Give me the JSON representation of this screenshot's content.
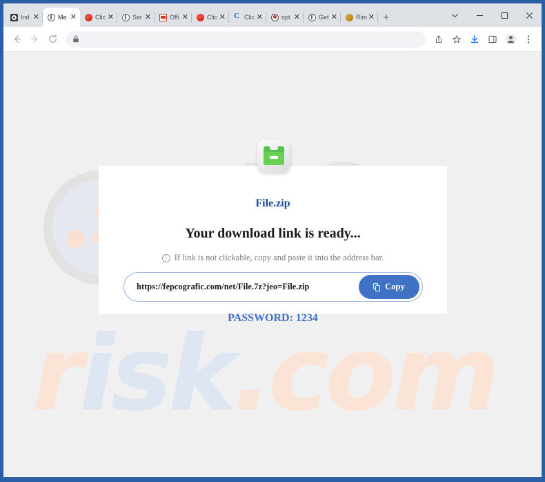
{
  "browser": {
    "tabs": [
      {
        "title": "Ind",
        "favicon": "film-reel-icon",
        "active": false
      },
      {
        "title": "Me",
        "favicon": "globe-icon",
        "active": true
      },
      {
        "title": "Clic",
        "favicon": "red-circle-icon",
        "active": false
      },
      {
        "title": "Ser",
        "favicon": "globe-icon",
        "active": false
      },
      {
        "title": "Offi",
        "favicon": "red-document-icon",
        "active": false
      },
      {
        "title": "Clic",
        "favicon": "red-circle-icon",
        "active": false
      },
      {
        "title": "Clic",
        "favicon": "blue-c-icon",
        "active": false
      },
      {
        "title": "opt",
        "favicon": "record-ring-icon",
        "active": false
      },
      {
        "title": "Get",
        "favicon": "globe-icon",
        "active": false
      },
      {
        "title": "Rim",
        "favicon": "gold-circle-icon",
        "active": false
      }
    ],
    "tab_close_label": "✕",
    "new_tab_label": "+",
    "window_controls": {
      "tab_search": "chevron-down-icon",
      "minimize": "minimize-icon",
      "maximize": "maximize-icon",
      "close": "close-icon"
    },
    "toolbar": {
      "back": "back-arrow-icon",
      "forward": "forward-arrow-icon",
      "reload": "reload-icon",
      "lock": "lock-icon",
      "address_value": "",
      "address_placeholder": "",
      "share": "share-icon",
      "bookmark": "star-icon",
      "download": "download-icon",
      "side_panel": "side-panel-icon",
      "profile": "profile-avatar-icon",
      "menu": "three-dot-menu-icon"
    }
  },
  "page": {
    "watermark": {
      "top_text": "pc",
      "bottom_pink": "r",
      "bottom_blue": "isk",
      "bottom_pink2": ".com",
      "magnifier": "magnifier-watermark"
    },
    "card": {
      "file_icon": "green-zip-folder-icon",
      "filename": "File.zip",
      "headline": "Your download link is ready...",
      "info_icon": "info-circle-icon",
      "subtext": "If link is not clickable, copy and paste it into the address bar.",
      "url": "https://fepcografic.com/net/File.7z?jeo=File.zip",
      "copy_icon": "copy-icon",
      "copy_label": "Copy",
      "password": "PASSWORD: 1234"
    }
  },
  "colors": {
    "window_frame": "#2a5fa5",
    "accent_blue": "#3f72c4",
    "link_blue": "#1d4da0",
    "folder_green": "#69d055",
    "page_bg": "#f0f0f0"
  }
}
